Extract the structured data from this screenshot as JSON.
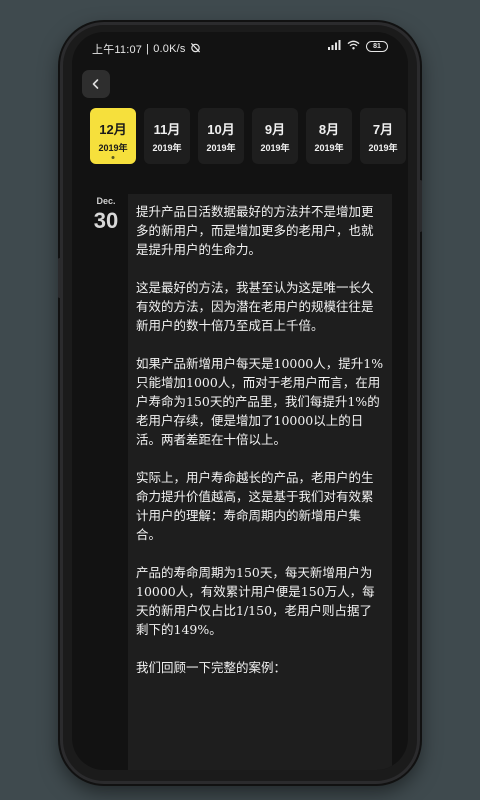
{
  "status_bar": {
    "time": "上午11:07",
    "separator": "|",
    "speed": "0.0K/s",
    "battery": "81"
  },
  "months": [
    {
      "month": "12月",
      "year": "2019年",
      "active": true
    },
    {
      "month": "11月",
      "year": "2019年",
      "active": false
    },
    {
      "month": "10月",
      "year": "2019年",
      "active": false
    },
    {
      "month": "9月",
      "year": "2019年",
      "active": false
    },
    {
      "month": "8月",
      "year": "2019年",
      "active": false
    },
    {
      "month": "7月",
      "year": "2019年",
      "active": false
    }
  ],
  "entry": {
    "month_abbr": "Dec.",
    "day": "30",
    "paragraphs": [
      "提升产品日活数据最好的方法并不是增加更多的新用户，而是增加更多的老用户，也就是提升用户的生命力。",
      "这是最好的方法，我甚至认为这是唯一长久有效的方法，因为潜在老用户的规模往往是新用户的数十倍乃至成百上千倍。",
      "如果产品新增用户每天是10000人，提升1%只能增加1000人，而对于老用户而言，在用户寿命为150天的产品里，我们每提升1%的老用户存续，便是增加了10000以上的日活。两者差距在十倍以上。",
      "实际上，用户寿命越长的产品，老用户的生命力提升价值越高，这是基于我们对有效累计用户的理解：寿命周期内的新增用户集合。",
      "产品的寿命周期为150天，每天新增用户为10000人，有效累计用户便是150万人，每天的新用户仅占比1/150，老用户则占据了剩下的149%。",
      "我们回顾一下完整的案例："
    ]
  },
  "colors": {
    "accent": "#f6e03c",
    "screen_bg": "#121212",
    "card_bg": "#1e1e1e"
  },
  "icons": {
    "back": "chevron-left-icon",
    "mute": "alarm-off-icon",
    "signal": "signal-icon",
    "wifi": "wifi-icon",
    "battery": "battery-icon"
  }
}
